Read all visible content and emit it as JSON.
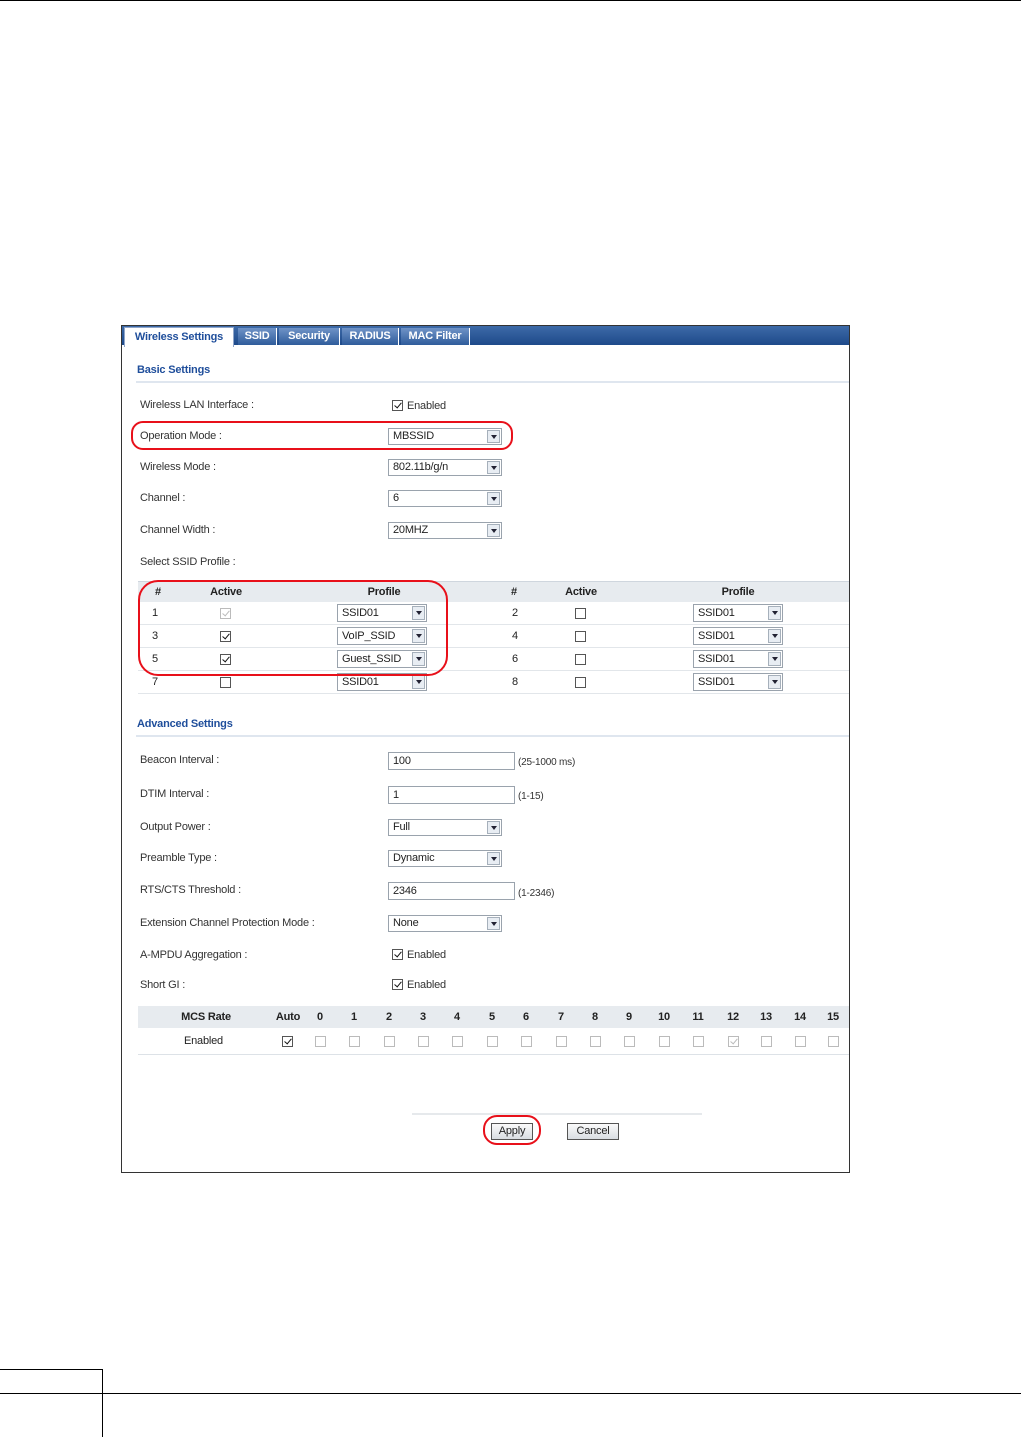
{
  "tabs": [
    "Wireless Settings",
    "SSID",
    "Security",
    "RADIUS",
    "MAC Filter"
  ],
  "basic": {
    "title": "Basic Settings",
    "wlan_label": "Wireless LAN Interface :",
    "wlan_enabled": "Enabled",
    "op_mode_label": "Operation Mode :",
    "op_mode_value": "MBSSID",
    "wireless_mode_label": "Wireless Mode :",
    "wireless_mode_value": "802.11b/g/n",
    "channel_label": "Channel :",
    "channel_value": "6",
    "channel_width_label": "Channel Width :",
    "channel_width_value": "20MHZ",
    "ssid_profile_label": "Select SSID Profile :"
  },
  "ssid_table": {
    "headers": {
      "num": "#",
      "active": "Active",
      "profile": "Profile"
    },
    "rows": [
      {
        "l_num": "1",
        "l_active": true,
        "l_disabled": true,
        "l_profile": "SSID01",
        "r_num": "2",
        "r_active": false,
        "r_profile": "SSID01"
      },
      {
        "l_num": "3",
        "l_active": true,
        "l_disabled": false,
        "l_profile": "VoIP_SSID",
        "r_num": "4",
        "r_active": false,
        "r_profile": "SSID01"
      },
      {
        "l_num": "5",
        "l_active": true,
        "l_disabled": false,
        "l_profile": "Guest_SSID",
        "r_num": "6",
        "r_active": false,
        "r_profile": "SSID01"
      },
      {
        "l_num": "7",
        "l_active": false,
        "l_disabled": false,
        "l_profile": "SSID01",
        "r_num": "8",
        "r_active": false,
        "r_profile": "SSID01"
      }
    ]
  },
  "advanced": {
    "title": "Advanced Settings",
    "beacon_label": "Beacon Interval :",
    "beacon_value": "100",
    "beacon_hint": "(25-1000 ms)",
    "dtim_label": "DTIM Interval :",
    "dtim_value": "1",
    "dtim_hint": "(1-15)",
    "power_label": "Output Power :",
    "power_value": "Full",
    "preamble_label": "Preamble Type :",
    "preamble_value": "Dynamic",
    "rts_label": "RTS/CTS Threshold :",
    "rts_value": "2346",
    "rts_hint": "(1-2346)",
    "ecp_label": "Extension Channel Protection Mode :",
    "ecp_value": "None",
    "ampdu_label": "A-MPDU Aggregation :",
    "ampdu_enabled": "Enabled",
    "sgi_label": "Short GI :",
    "sgi_enabled": "Enabled"
  },
  "mcs": {
    "rate_header": "MCS Rate",
    "auto_header": "Auto",
    "columns": [
      "0",
      "1",
      "2",
      "3",
      "4",
      "5",
      "6",
      "7",
      "8",
      "9",
      "10",
      "11",
      "12",
      "13",
      "14",
      "15"
    ],
    "row_label": "Enabled"
  },
  "buttons": {
    "apply": "Apply",
    "cancel": "Cancel"
  },
  "colors": {
    "accent": "#1f4e9b",
    "highlight": "#e8101a"
  }
}
